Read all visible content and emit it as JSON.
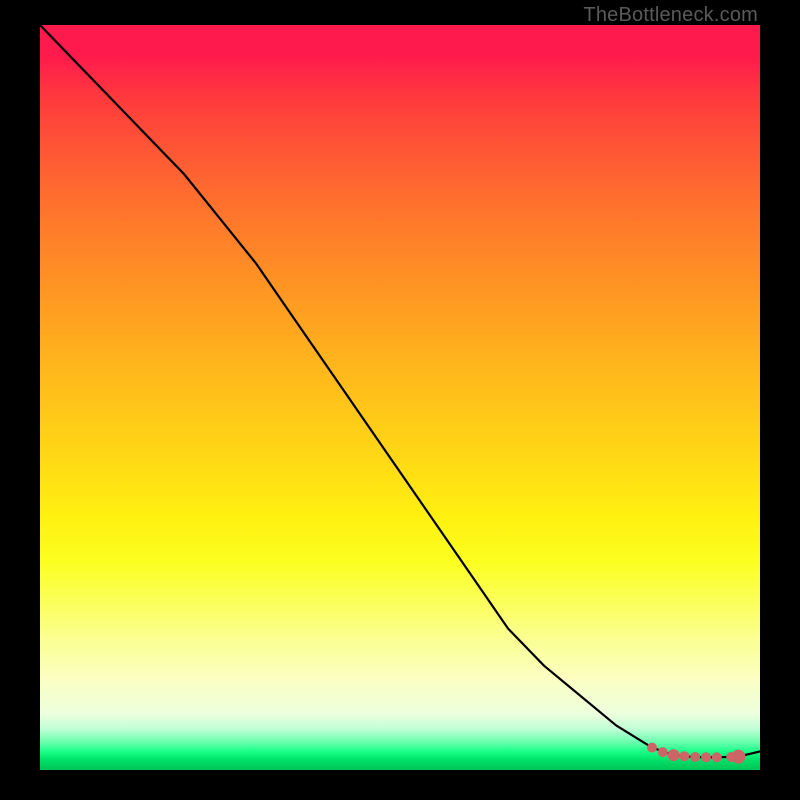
{
  "watermark": "TheBottleneck.com",
  "colors": {
    "border": "#000000",
    "line": "#000000",
    "marker": "#cc6666",
    "gradient_top": "#ff1a4d",
    "gradient_bottom": "#00c455"
  },
  "chart_data": {
    "type": "line",
    "title": "",
    "xlabel": "",
    "ylabel": "",
    "xlim": [
      0,
      100
    ],
    "ylim": [
      0,
      100
    ],
    "grid": false,
    "legend": false,
    "series": [
      {
        "name": "curve",
        "x": [
          0,
          5,
          10,
          15,
          20,
          25,
          30,
          35,
          40,
          45,
          50,
          55,
          60,
          65,
          70,
          75,
          80,
          85,
          88,
          90,
          92,
          94,
          97,
          100
        ],
        "y": [
          100,
          95,
          90,
          85,
          80,
          74,
          68,
          61,
          54,
          47,
          40,
          33,
          26,
          19,
          14,
          10,
          6,
          3,
          2,
          1.8,
          1.7,
          1.7,
          1.8,
          2.5
        ]
      }
    ],
    "markers": {
      "name": "highlight-points",
      "color": "#cc6666",
      "x": [
        85,
        86.5,
        88,
        89.5,
        91,
        92.5,
        94,
        96,
        97
      ],
      "y": [
        3.0,
        2.4,
        2.0,
        1.85,
        1.75,
        1.7,
        1.7,
        1.75,
        1.8
      ],
      "size": [
        5,
        5,
        6,
        5,
        5,
        5,
        5,
        5,
        7
      ]
    }
  }
}
